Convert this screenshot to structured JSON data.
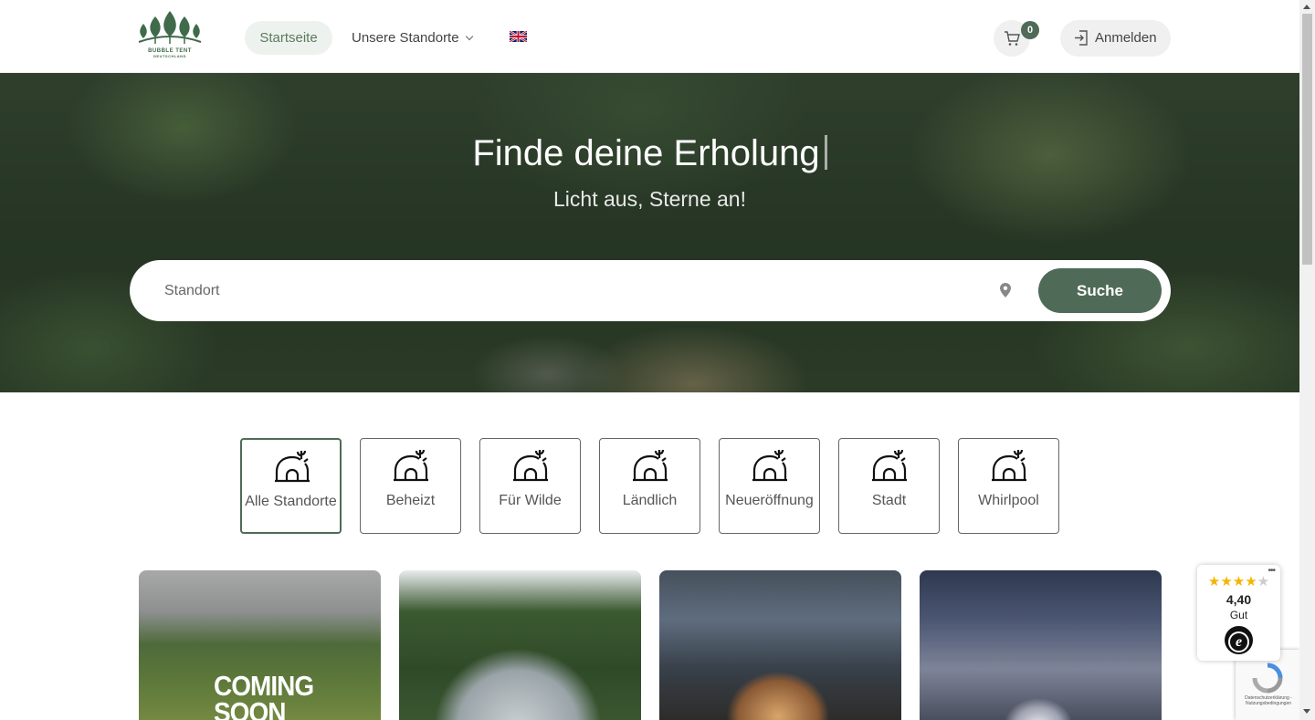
{
  "header": {
    "logo": {
      "line1": "BUBBLE TENT",
      "line2": "DEUTSCHLAND",
      "icon": "tree-logo-icon"
    },
    "nav": [
      {
        "label": "Startseite",
        "active": true
      },
      {
        "label": "Unsere Standorte",
        "icon": "chevron-down-icon"
      }
    ],
    "language_icon": "uk-flag-icon",
    "cart": {
      "count": "0",
      "icon": "cart-icon"
    },
    "login": {
      "label": "Anmelden",
      "icon": "login-icon"
    }
  },
  "hero": {
    "title": "Finde deine Erholung",
    "subtitle": "Licht aus, Sterne an!",
    "search": {
      "placeholder": "Standort",
      "icon": "location-pin-icon",
      "button": "Suche"
    }
  },
  "categories": {
    "icon": "bubble-tent-icon",
    "selected": "Alle Standorte",
    "items": [
      {
        "label": "Alle Standorte"
      },
      {
        "label": "Beheizt"
      },
      {
        "label": "Für Wilde"
      },
      {
        "label": "Ländlich"
      },
      {
        "label": "Neueröffnung"
      },
      {
        "label": "Stadt"
      },
      {
        "label": "Whirlpool"
      }
    ]
  },
  "cards": [
    {
      "overlay_line1": "COMING",
      "overlay_line2": "SOON"
    },
    {},
    {},
    {}
  ],
  "trust_badge": {
    "stars": "★★★★",
    "half_star": "★",
    "rating": "4,40",
    "grade": "Gut",
    "seal": "e",
    "menu": "•••"
  },
  "recaptcha": {
    "text": "Datenschutzerklärung - Nutzungsbedingungen"
  },
  "colors": {
    "brand_green": "#4f6b57",
    "star_yellow": "#f5b500"
  }
}
